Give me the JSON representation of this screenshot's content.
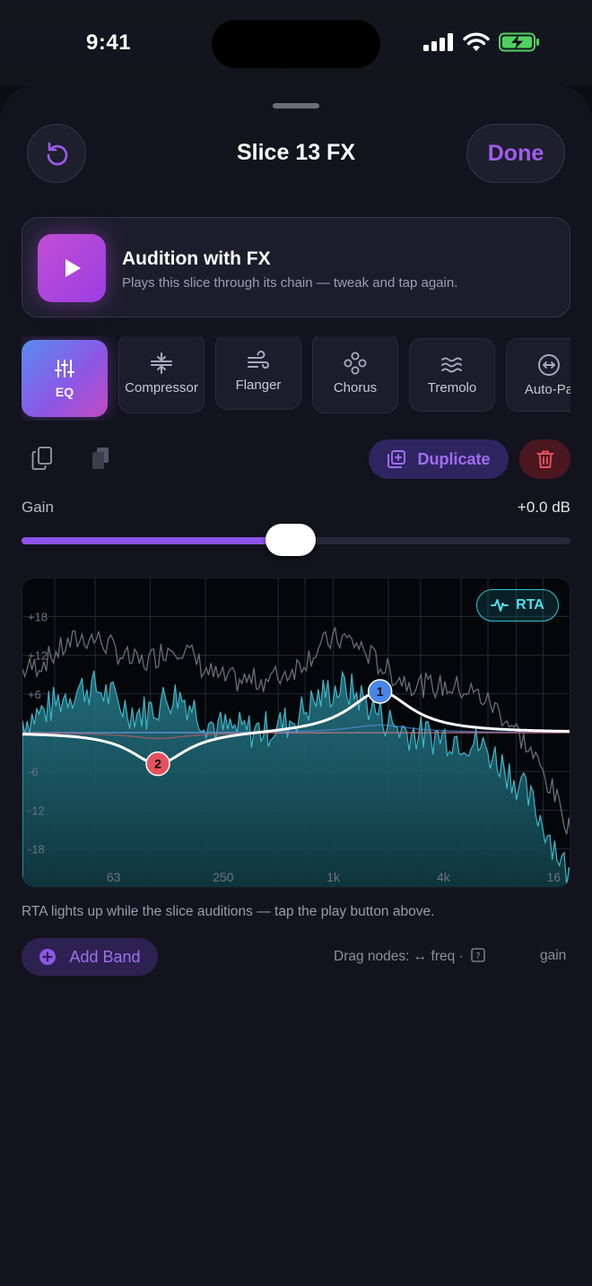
{
  "status_bar": {
    "time": "9:41"
  },
  "header": {
    "title": "Slice 13 FX",
    "done_label": "Done"
  },
  "audition": {
    "title": "Audition with FX",
    "subtitle": "Plays this slice through its chain — tweak and tap again."
  },
  "fx_tabs": [
    {
      "label": "EQ",
      "icon": "sliders-icon",
      "active": true
    },
    {
      "label": "Compressor",
      "icon": "compressor-icon",
      "active": false
    },
    {
      "label": "Flanger",
      "icon": "wind-icon",
      "active": false
    },
    {
      "label": "Chorus",
      "icon": "circles-icon",
      "active": false
    },
    {
      "label": "Tremolo",
      "icon": "waves-icon",
      "active": false
    },
    {
      "label": "Auto-Pa",
      "icon": "pan-arrows-icon",
      "active": false
    }
  ],
  "toolbar": {
    "duplicate_label": "Duplicate"
  },
  "gain": {
    "label": "Gain",
    "value_text": "+0.0 dB",
    "fraction": 0.49
  },
  "eq": {
    "rta_label": "RTA",
    "db_labels": [
      "+18",
      "+12",
      "+6",
      "-6",
      "-12",
      "-18"
    ],
    "freq_labels": [
      "63",
      "250",
      "1k",
      "4k",
      "16"
    ],
    "nodes": [
      {
        "label": "1",
        "freq_hz": 1800,
        "gain_db": 6.5,
        "color": "#4a86e8"
      },
      {
        "label": "2",
        "freq_hz": 110,
        "gain_db": -5,
        "color": "#e5525e"
      }
    ]
  },
  "footer": {
    "rta_hint": "RTA lights up while the slice auditions — tap the play button above.",
    "add_band_label": "Add Band",
    "drag_hint": "Drag nodes: ↔ freq ·",
    "drag_hint_gain": "gain"
  },
  "colors": {
    "accent": "#8e54ea",
    "rta": "#2fc6d6",
    "danger": "#e5525e",
    "background": "#12131c"
  }
}
